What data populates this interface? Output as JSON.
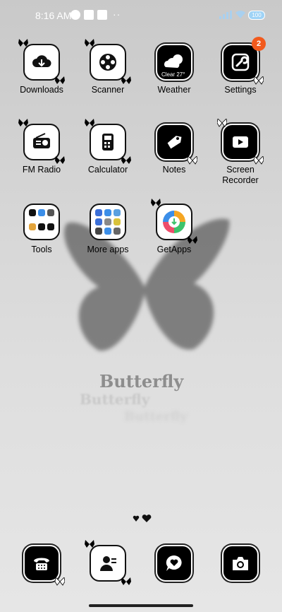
{
  "status_bar": {
    "time": "8:16 AM",
    "battery": "100"
  },
  "wallpaper": {
    "text": "Butterfly",
    "echo_text_1": "Butterfly",
    "echo_text_2": "Butterfly"
  },
  "apps": [
    {
      "label": "Downloads",
      "icon": "download-cloud-icon"
    },
    {
      "label": "Scanner",
      "icon": "film-reel-icon"
    },
    {
      "label": "Weather",
      "icon": "cloud-sun-icon",
      "temp_text": "Clear 27°"
    },
    {
      "label": "Settings",
      "icon": "wrench-icon",
      "badge": "2"
    },
    {
      "label": "FM Radio",
      "icon": "radio-icon"
    },
    {
      "label": "Calculator",
      "icon": "calculator-icon"
    },
    {
      "label": "Notes",
      "icon": "tag-icon"
    },
    {
      "label": "Screen Recorder",
      "icon": "video-play-icon"
    },
    {
      "label": "Tools",
      "icon": "folder-icon"
    },
    {
      "label": "More apps",
      "icon": "folder-icon"
    },
    {
      "label": "GetApps",
      "icon": "getapps-icon"
    }
  ],
  "dock": [
    {
      "icon": "phone-icon"
    },
    {
      "icon": "contacts-icon"
    },
    {
      "icon": "messages-icon"
    },
    {
      "icon": "camera-icon"
    }
  ]
}
